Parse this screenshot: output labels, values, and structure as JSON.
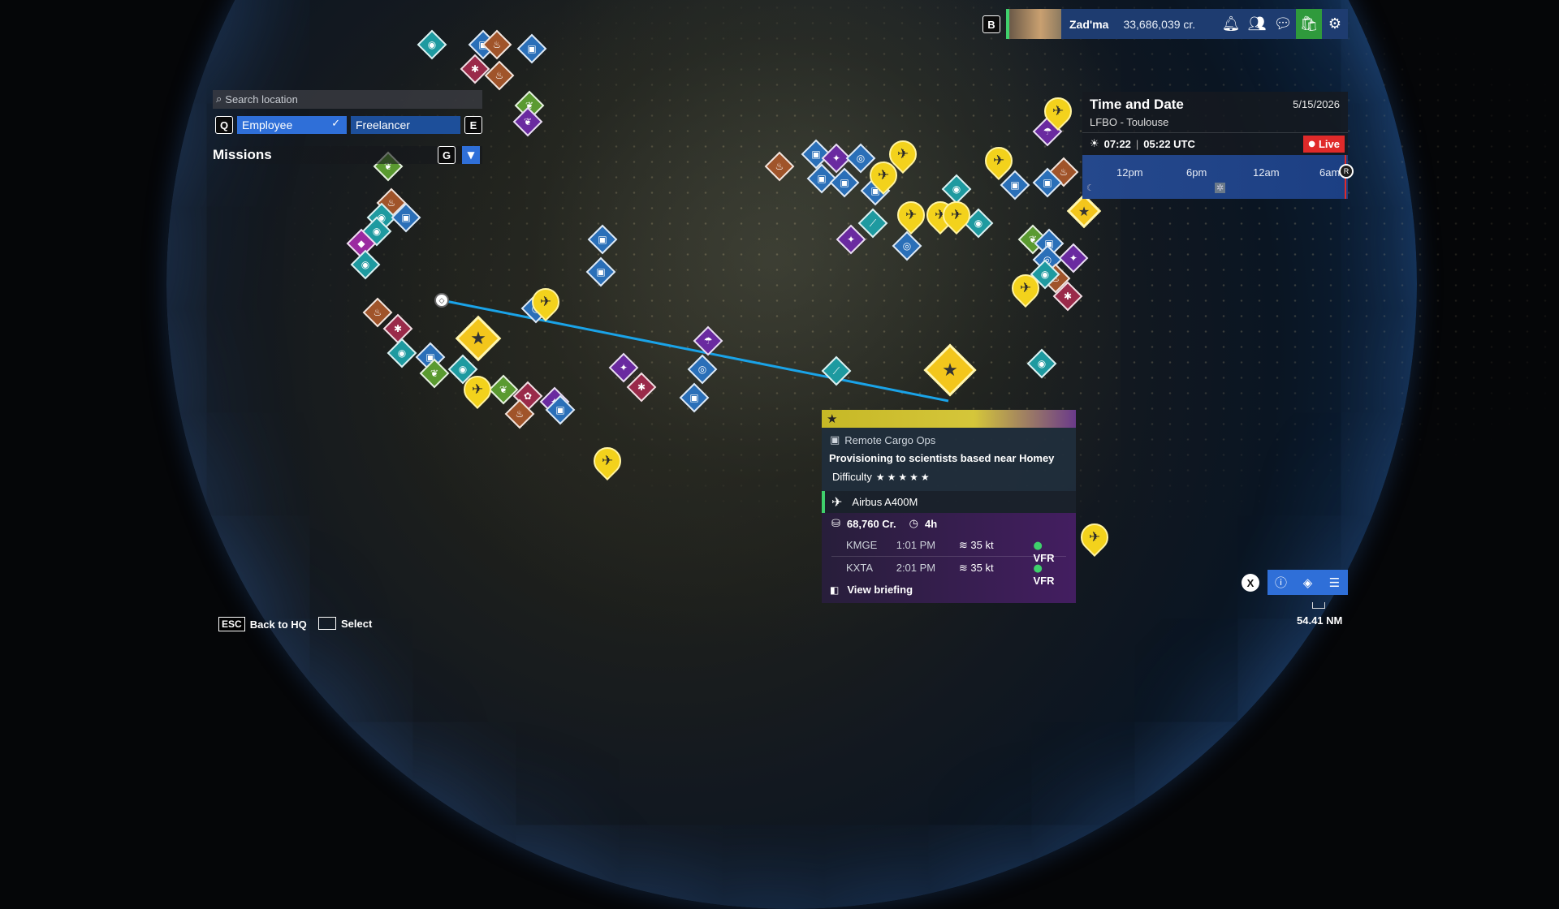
{
  "topbar": {
    "key_hint": "B",
    "username": "Zad'ma",
    "credits": "33,686,039 cr.",
    "icons": [
      "bell-icon",
      "friends-icon",
      "chat-icon",
      "store-icon",
      "gear-icon"
    ]
  },
  "search": {
    "placeholder": "Search location"
  },
  "filters": {
    "key_left": "Q",
    "key_right": "E",
    "employee_label": "Employee",
    "freelancer_label": "Freelancer"
  },
  "missions": {
    "label": "Missions",
    "key": "G"
  },
  "time_panel": {
    "title": "Time and Date",
    "date": "5/15/2026",
    "airport": "LFBO - Toulouse",
    "local_time": "07:22",
    "utc_time": "05:22 UTC",
    "live_label": "Live",
    "ticks": [
      "12pm",
      "6pm",
      "12am",
      "6am"
    ],
    "reset_key": "R"
  },
  "mission_card": {
    "category": "Remote Cargo Ops",
    "description": "Provisioning to scientists based near Homey",
    "difficulty_label": "Difficulty",
    "difficulty_stars": 5,
    "aircraft": "Airbus A400M",
    "reward": "68,760 Cr.",
    "duration": "4h",
    "legs": [
      {
        "airport": "KMGE",
        "time": "1:01 PM",
        "wind": "35 kt",
        "rules": "VFR"
      },
      {
        "airport": "KXTA",
        "time": "2:01 PM",
        "wind": "35 kt",
        "rules": "VFR"
      }
    ],
    "briefing_label": "View briefing"
  },
  "map_tools": {
    "close_key": "X",
    "scale": "54.41 NM"
  },
  "hints": {
    "back_key": "ESC",
    "back_label": "Back to HQ",
    "select_label": "Select"
  },
  "colors": {
    "accent_blue": "#2f6fd8",
    "live_red": "#e02a2a",
    "route": "#1aa3e8",
    "pin_yellow": "#f3d21c"
  }
}
